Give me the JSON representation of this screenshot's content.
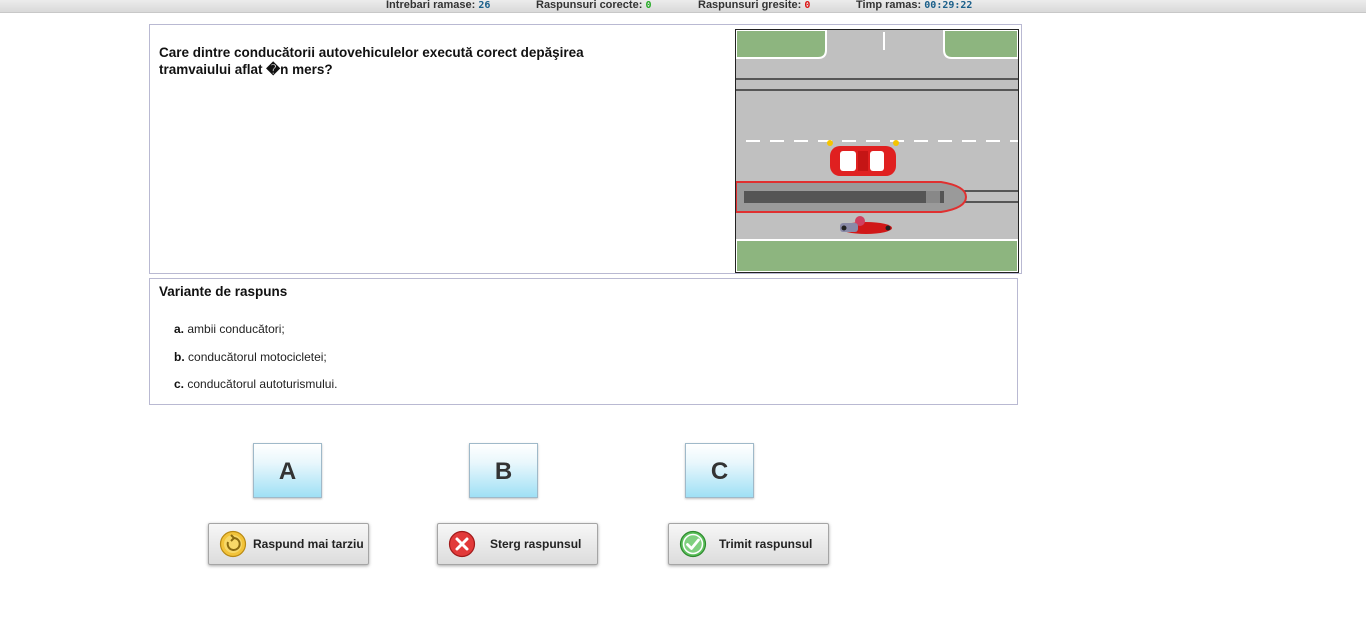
{
  "status": {
    "remaining_label": "Intrebari ramase:",
    "remaining_value": "26",
    "correct_label": "Raspunsuri corecte:",
    "correct_value": "0",
    "wrong_label": "Raspunsuri gresite:",
    "wrong_value": "0",
    "time_label": "Timp ramas:",
    "time_value": "00:29:22"
  },
  "question": {
    "text": "Care dintre conducătorii autovehiculelor execută corect depăşirea tramvaiului aflat �n mers?"
  },
  "answers": {
    "title": "Variante de raspuns",
    "items": [
      {
        "letter": "a.",
        "text": "ambii conducători;"
      },
      {
        "letter": "b.",
        "text": "conducătorul motocicletei;"
      },
      {
        "letter": "c.",
        "text": "conducătorul autoturismului."
      }
    ]
  },
  "letter_buttons": [
    "A",
    "B",
    "C"
  ],
  "actions": {
    "later": "Raspund mai tarziu",
    "clear": "Sterg raspunsul",
    "submit": "Trimit raspunsul"
  },
  "colors": {
    "grass": "#8db57f",
    "road": "#bfbfbf",
    "tram_outline": "#e03030",
    "car": "#e02020"
  }
}
